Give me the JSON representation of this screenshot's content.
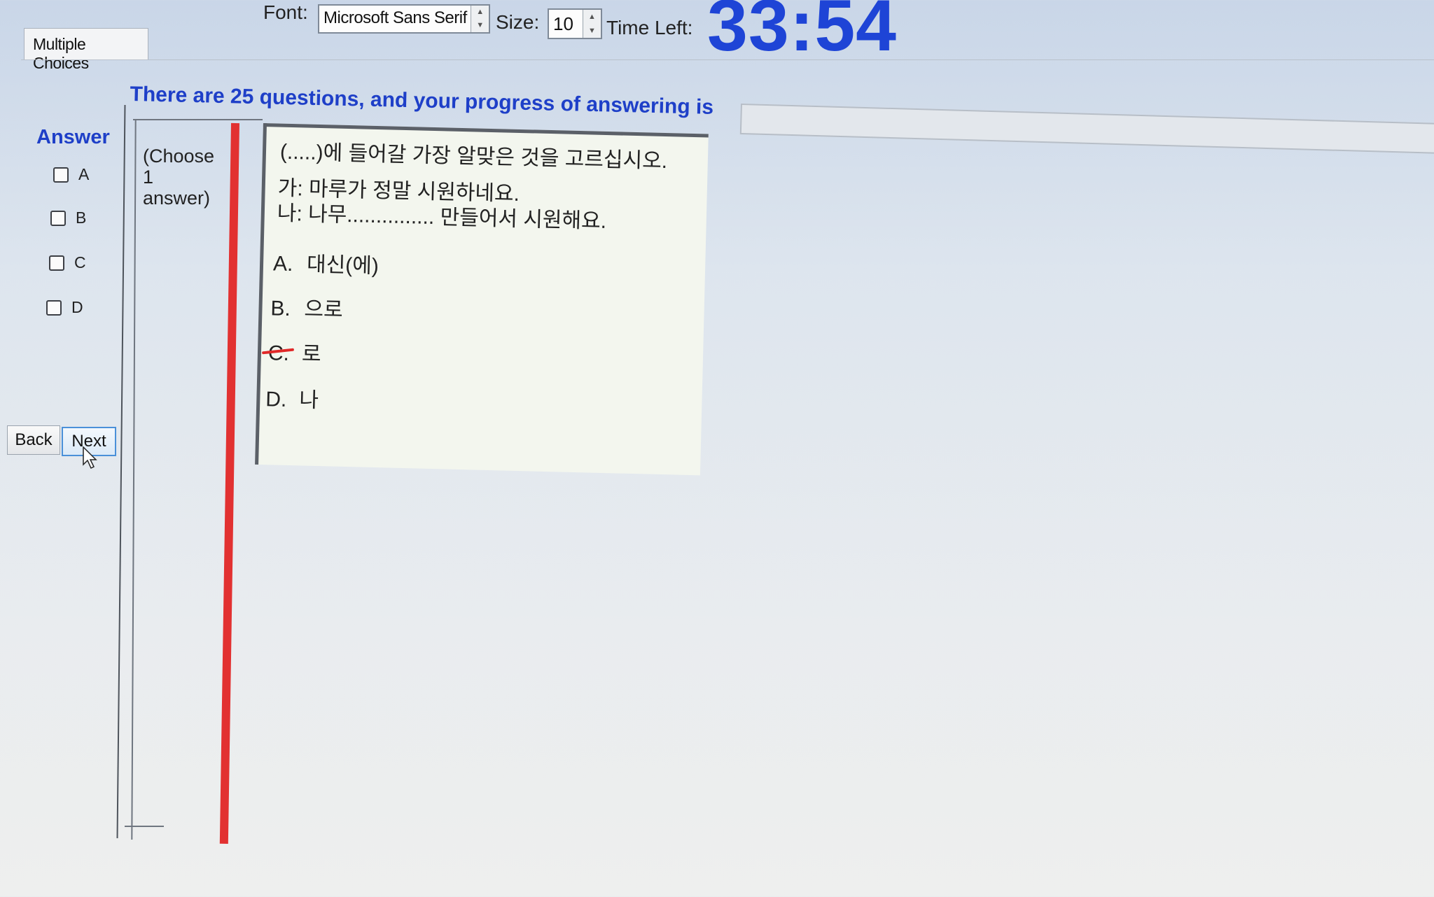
{
  "toolbar": {
    "font_label": "Font:",
    "font_value": "Microsoft Sans Serif",
    "size_label": "Size:",
    "size_value": "10",
    "time_label": "Time Left:",
    "time_value": "33:54"
  },
  "tab": {
    "label": "Multiple Choices"
  },
  "progress": {
    "text": "There are 25 questions, and your progress of answering is",
    "value_percent": 0
  },
  "answer": {
    "title": "Answer",
    "options": [
      "A",
      "B",
      "C",
      "D"
    ],
    "back_label": "Back",
    "next_label": "Next"
  },
  "instruction": {
    "line1": "(Choose",
    "line2": "1",
    "line3": "answer)"
  },
  "question": {
    "stem": "(.....)에 들어갈 가장 알맞은 것을 고르십시오.",
    "line1": "가: 마루가 정말 시원하네요.",
    "line2": "나: 나무............... 만들어서 시원해요.",
    "choices": [
      {
        "letter": "A.",
        "text": "대신(에)"
      },
      {
        "letter": "B.",
        "text": "으로"
      },
      {
        "letter": "C.",
        "text": "로"
      },
      {
        "letter": "D.",
        "text": "나"
      }
    ]
  },
  "icons": {
    "cursor": "mouse-pointer-icon",
    "spinner": "spin-arrows-icon"
  }
}
